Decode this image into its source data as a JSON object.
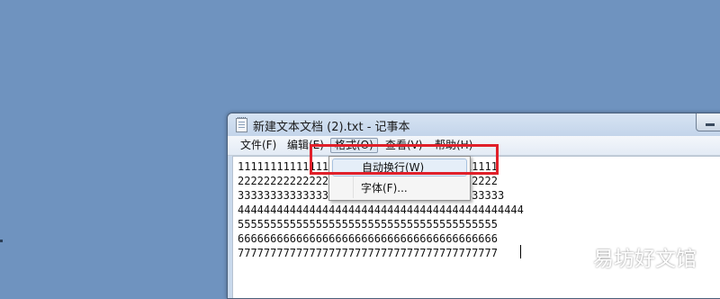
{
  "window": {
    "title": "新建文本文档 (2).txt - 记事本"
  },
  "menubar": {
    "items": [
      {
        "label": "文件(F)"
      },
      {
        "label": "编辑(E)"
      },
      {
        "label": "格式(O)"
      },
      {
        "label": "查看(V)"
      },
      {
        "label": "帮助(H)"
      }
    ]
  },
  "format_menu": {
    "items": [
      {
        "label": "自动换行(W)"
      },
      {
        "label": "字体(F)..."
      }
    ]
  },
  "editor": {
    "lines": [
      "1111111111111111111111111111111111111111",
      "2222222222222222222222222222222222222222",
      "33333333333333333333333333333333333333333",
      "44444444444444444444444444444444444444444444",
      "5555555555555555555555555555555555555555",
      "6666666666666666666666666666666666666666",
      "7777777777777777777777777777777777777777"
    ]
  },
  "watermark": {
    "text": "易坊好文馆"
  },
  "colors": {
    "desktop": "#6f93bf",
    "highlight": "#e0202a"
  }
}
